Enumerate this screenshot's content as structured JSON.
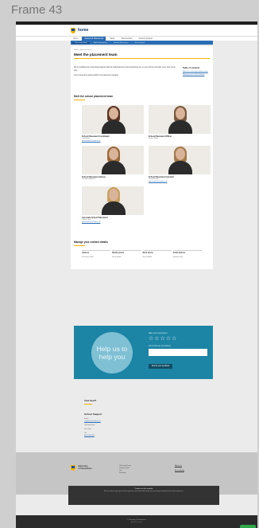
{
  "frame": {
    "label": "Frame 43"
  },
  "site": {
    "logo_text": "home"
  },
  "nav": {
    "items": [
      {
        "label": "Home"
      },
      {
        "label": "Careers & Placements"
      },
      {
        "label": "Study"
      },
      {
        "label": "Opportunities"
      },
      {
        "label": "Student Support"
      }
    ],
    "active_index": 1
  },
  "subnav": {
    "items": [
      {
        "label": "Placement team"
      },
      {
        "label": "Work Placements"
      },
      {
        "label": "Student Resources"
      },
      {
        "label": "Get Involved"
      }
    ],
    "active_index": 0
  },
  "breadcrumb": "Home > Meet the team",
  "page_title": "Meet the placement team",
  "intro": {
    "p1": "We're dedicated to connecting students with the right placement and supporting you on your journey through every step of the way.",
    "p2": "Get to know the people behind your placement support."
  },
  "toc": {
    "title": "Table of contents",
    "links": [
      "Meet the school placement team",
      "Manage your contact details"
    ]
  },
  "team_section": {
    "title": "Meet the school placement team"
  },
  "team": [
    {
      "name": "School Placement Coordinator",
      "role": "Coordinator",
      "email": "placements@school.ac.uk",
      "hair": "#5b3322"
    },
    {
      "name": "School Placement Officer",
      "role": "Senior Officer",
      "email": "",
      "hair": "#7a5a3e"
    },
    {
      "name": "School Placement Advisor",
      "role": "Placement Advisor",
      "email": "",
      "hair": "#9a6a3a"
    },
    {
      "name": "School Placement Assistant",
      "role": "Team Member",
      "email": "placements@school.ac.uk",
      "hair": "#a37a4a"
    },
    {
      "name": "Associate School Placement",
      "role": "Project Lead",
      "email": "placements@school.ac.uk",
      "hair": "#c8a060"
    }
  ],
  "contact_section": {
    "title": "Manage your contact details",
    "columns": [
      {
        "label": "Address",
        "value": "Placement Office"
      },
      {
        "label": "Mobile phone",
        "value": "Not provided"
      },
      {
        "label": "Work phone",
        "value": "Not provided"
      },
      {
        "label": "Email address",
        "value": "Student email"
      }
    ]
  },
  "banner": {
    "bubble_text": "Help us to help you",
    "question": "Rate your experience",
    "stars": [
      "☆",
      "☆",
      "☆",
      "☆",
      "☆"
    ],
    "comment_label": "Tell us how we can improve",
    "submit": "Submit your feedback",
    "color": "#1c84a4"
  },
  "below": {
    "title": "Visit SeeIT",
    "sub_title": "School Support",
    "email_label": "Email",
    "email_value": "support@school.ac.uk",
    "hours_label": "Opening times",
    "hours_value": "9am-5pm",
    "phone_label": "Tel",
    "phone_value": "0123 456 789"
  },
  "footer": {
    "logo_line1": "University",
    "logo_line2": "of Somewhere",
    "address": [
      "University House",
      "Campus Road",
      "City",
      "Postcode"
    ],
    "links": [
      "About Us",
      "Accessibility"
    ]
  },
  "cookie": {
    "title": "Cookies on this website",
    "body": "We use cookies to give you the best experience. Essential cookies keep the site working and optional ones help us improve it."
  },
  "band": {
    "line1": "© University of Somewhere",
    "line2": "All rights reserved"
  }
}
